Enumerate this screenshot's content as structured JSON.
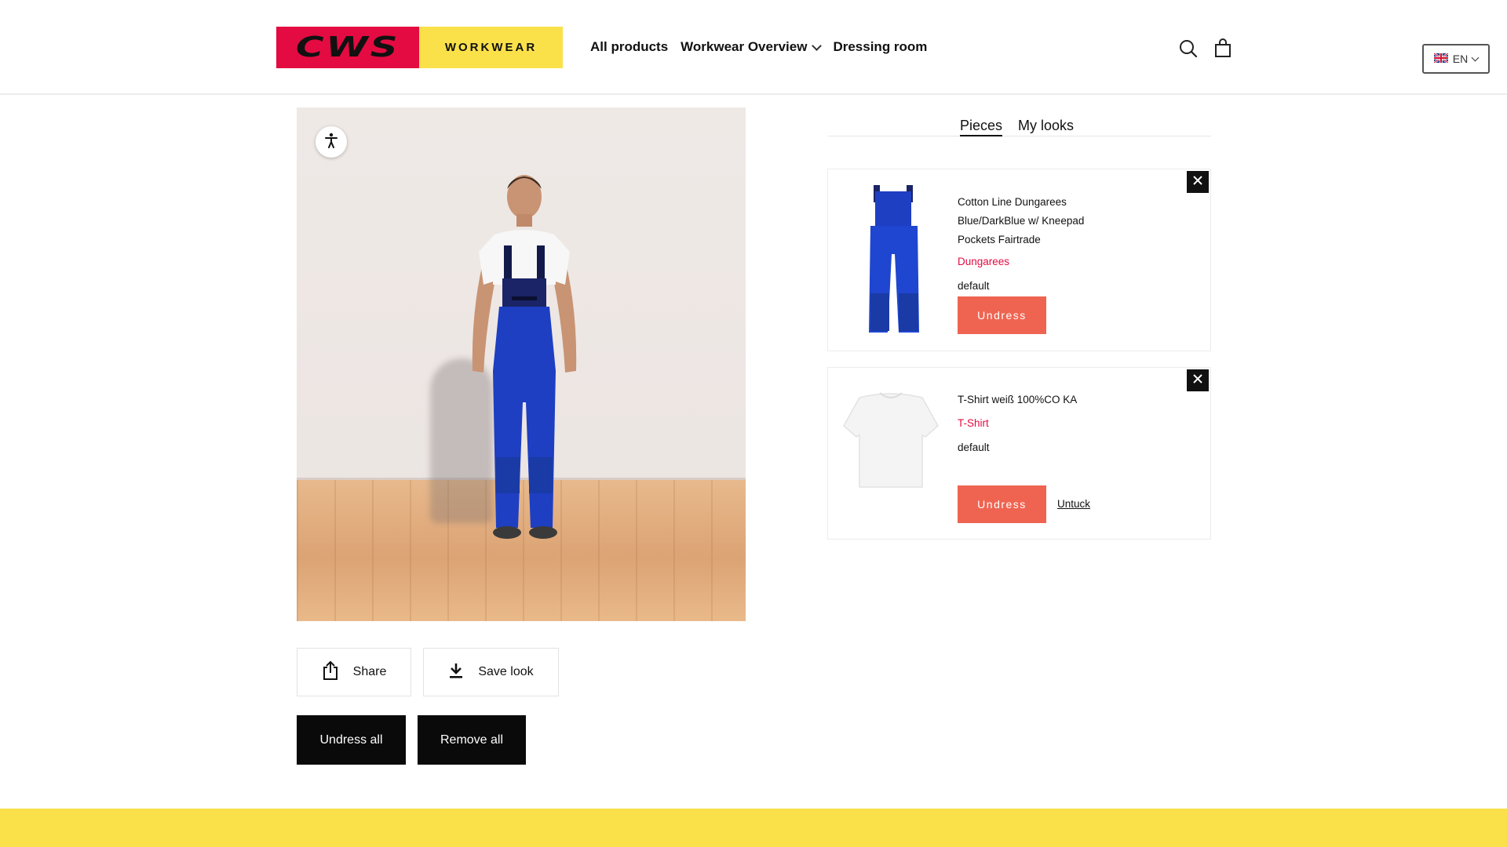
{
  "brand": {
    "logo_left": "CWS",
    "logo_right": "WORKWEAR",
    "red": "#e30b41",
    "yellow": "#fae14a"
  },
  "nav": [
    {
      "label": "All products"
    },
    {
      "label": "Workwear Overview",
      "has_dropdown": true
    },
    {
      "label": "Dressing room"
    }
  ],
  "header_icons": [
    "search-icon",
    "shopping-bag-icon"
  ],
  "language": {
    "selected": "EN",
    "flag": "uk-flag-icon"
  },
  "tabs": [
    {
      "label": "Pieces",
      "active": true
    },
    {
      "label": "My looks",
      "active": false
    }
  ],
  "pieces": [
    {
      "name": "Cotton Line Dungarees Blue/DarkBlue w/ Kneepad Pockets Fairtrade",
      "category": "Dungarees",
      "variant": "default",
      "undress_label": "Undress"
    },
    {
      "name": "T-Shirt weiß 100%CO KA",
      "category": "T-Shirt",
      "variant": "default",
      "undress_label": "Undress",
      "untuck_label": "Untuck"
    }
  ],
  "actions": {
    "share_label": "Share",
    "save_label": "Save look",
    "undress_all_label": "Undress all",
    "remove_all_label": "Remove all"
  },
  "colors": {
    "accent_orange": "#ef6451",
    "category_red": "#e30b41",
    "footer_yellow": "#fae14a"
  }
}
